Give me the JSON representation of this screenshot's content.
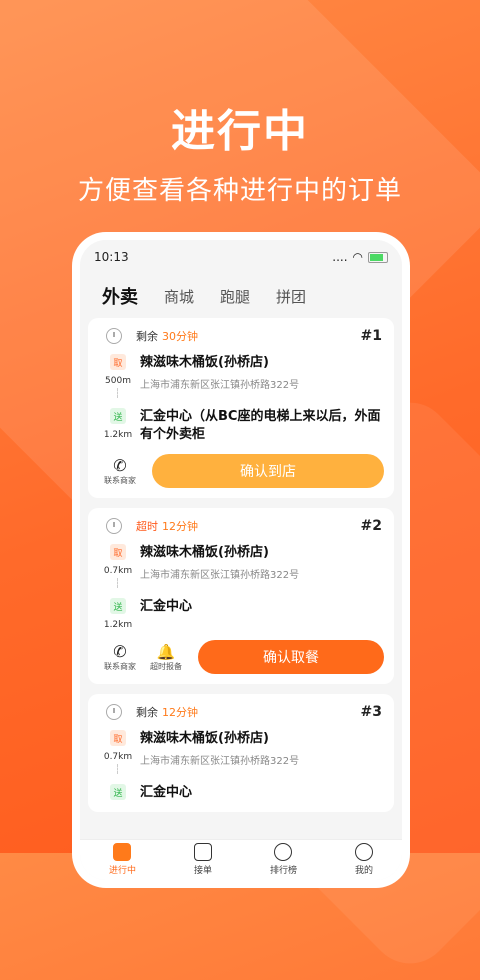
{
  "hero": {
    "title": "进行中",
    "subtitle": "方便查看各种进行中的订单"
  },
  "status": {
    "time": "10:13",
    "dots": "....",
    "wifi": "wifi-icon",
    "battery": "battery-icon"
  },
  "tabs": [
    "外卖",
    "商城",
    "跑腿",
    "拼团"
  ],
  "cards": [
    {
      "timer_label": "剩余",
      "timer_value": "30分钟",
      "order_no": "#1",
      "pickup_badge": "取",
      "pickup_dist": "500m",
      "pickup_name": "辣滋味木桶饭(孙桥店)",
      "pickup_addr": "上海市浦东新区张江镇孙桥路322号",
      "drop_badge": "送",
      "drop_dist": "1.2km",
      "drop_name": "汇金中心（从BC座的电梯上来以后，外面有个外卖柜",
      "contact": "联系商家",
      "button": "确认到店"
    },
    {
      "timer_label": "超时",
      "timer_value": "12分钟",
      "order_no": "#2",
      "pickup_badge": "取",
      "pickup_dist": "0.7km",
      "pickup_name": "辣滋味木桶饭(孙桥店)",
      "pickup_addr": "上海市浦东新区张江镇孙桥路322号",
      "drop_badge": "送",
      "drop_dist": "1.2km",
      "drop_name": "汇金中心",
      "contact": "联系商家",
      "report": "超时报备",
      "button": "确认取餐"
    },
    {
      "timer_label": "剩余",
      "timer_value": "12分钟",
      "order_no": "#3",
      "pickup_badge": "取",
      "pickup_dist": "0.7km",
      "pickup_name": "辣滋味木桶饭(孙桥店)",
      "pickup_addr": "上海市浦东新区张江镇孙桥路322号",
      "drop_badge": "送",
      "drop_name": "汇金中心"
    }
  ],
  "tabbar": [
    "进行中",
    "接单",
    "排行榜",
    "我的"
  ],
  "colors": {
    "accent": "#ff6a1a",
    "light_button": "#ffb13e",
    "pickup": "#ff6a2a",
    "drop": "#2fb54a"
  }
}
